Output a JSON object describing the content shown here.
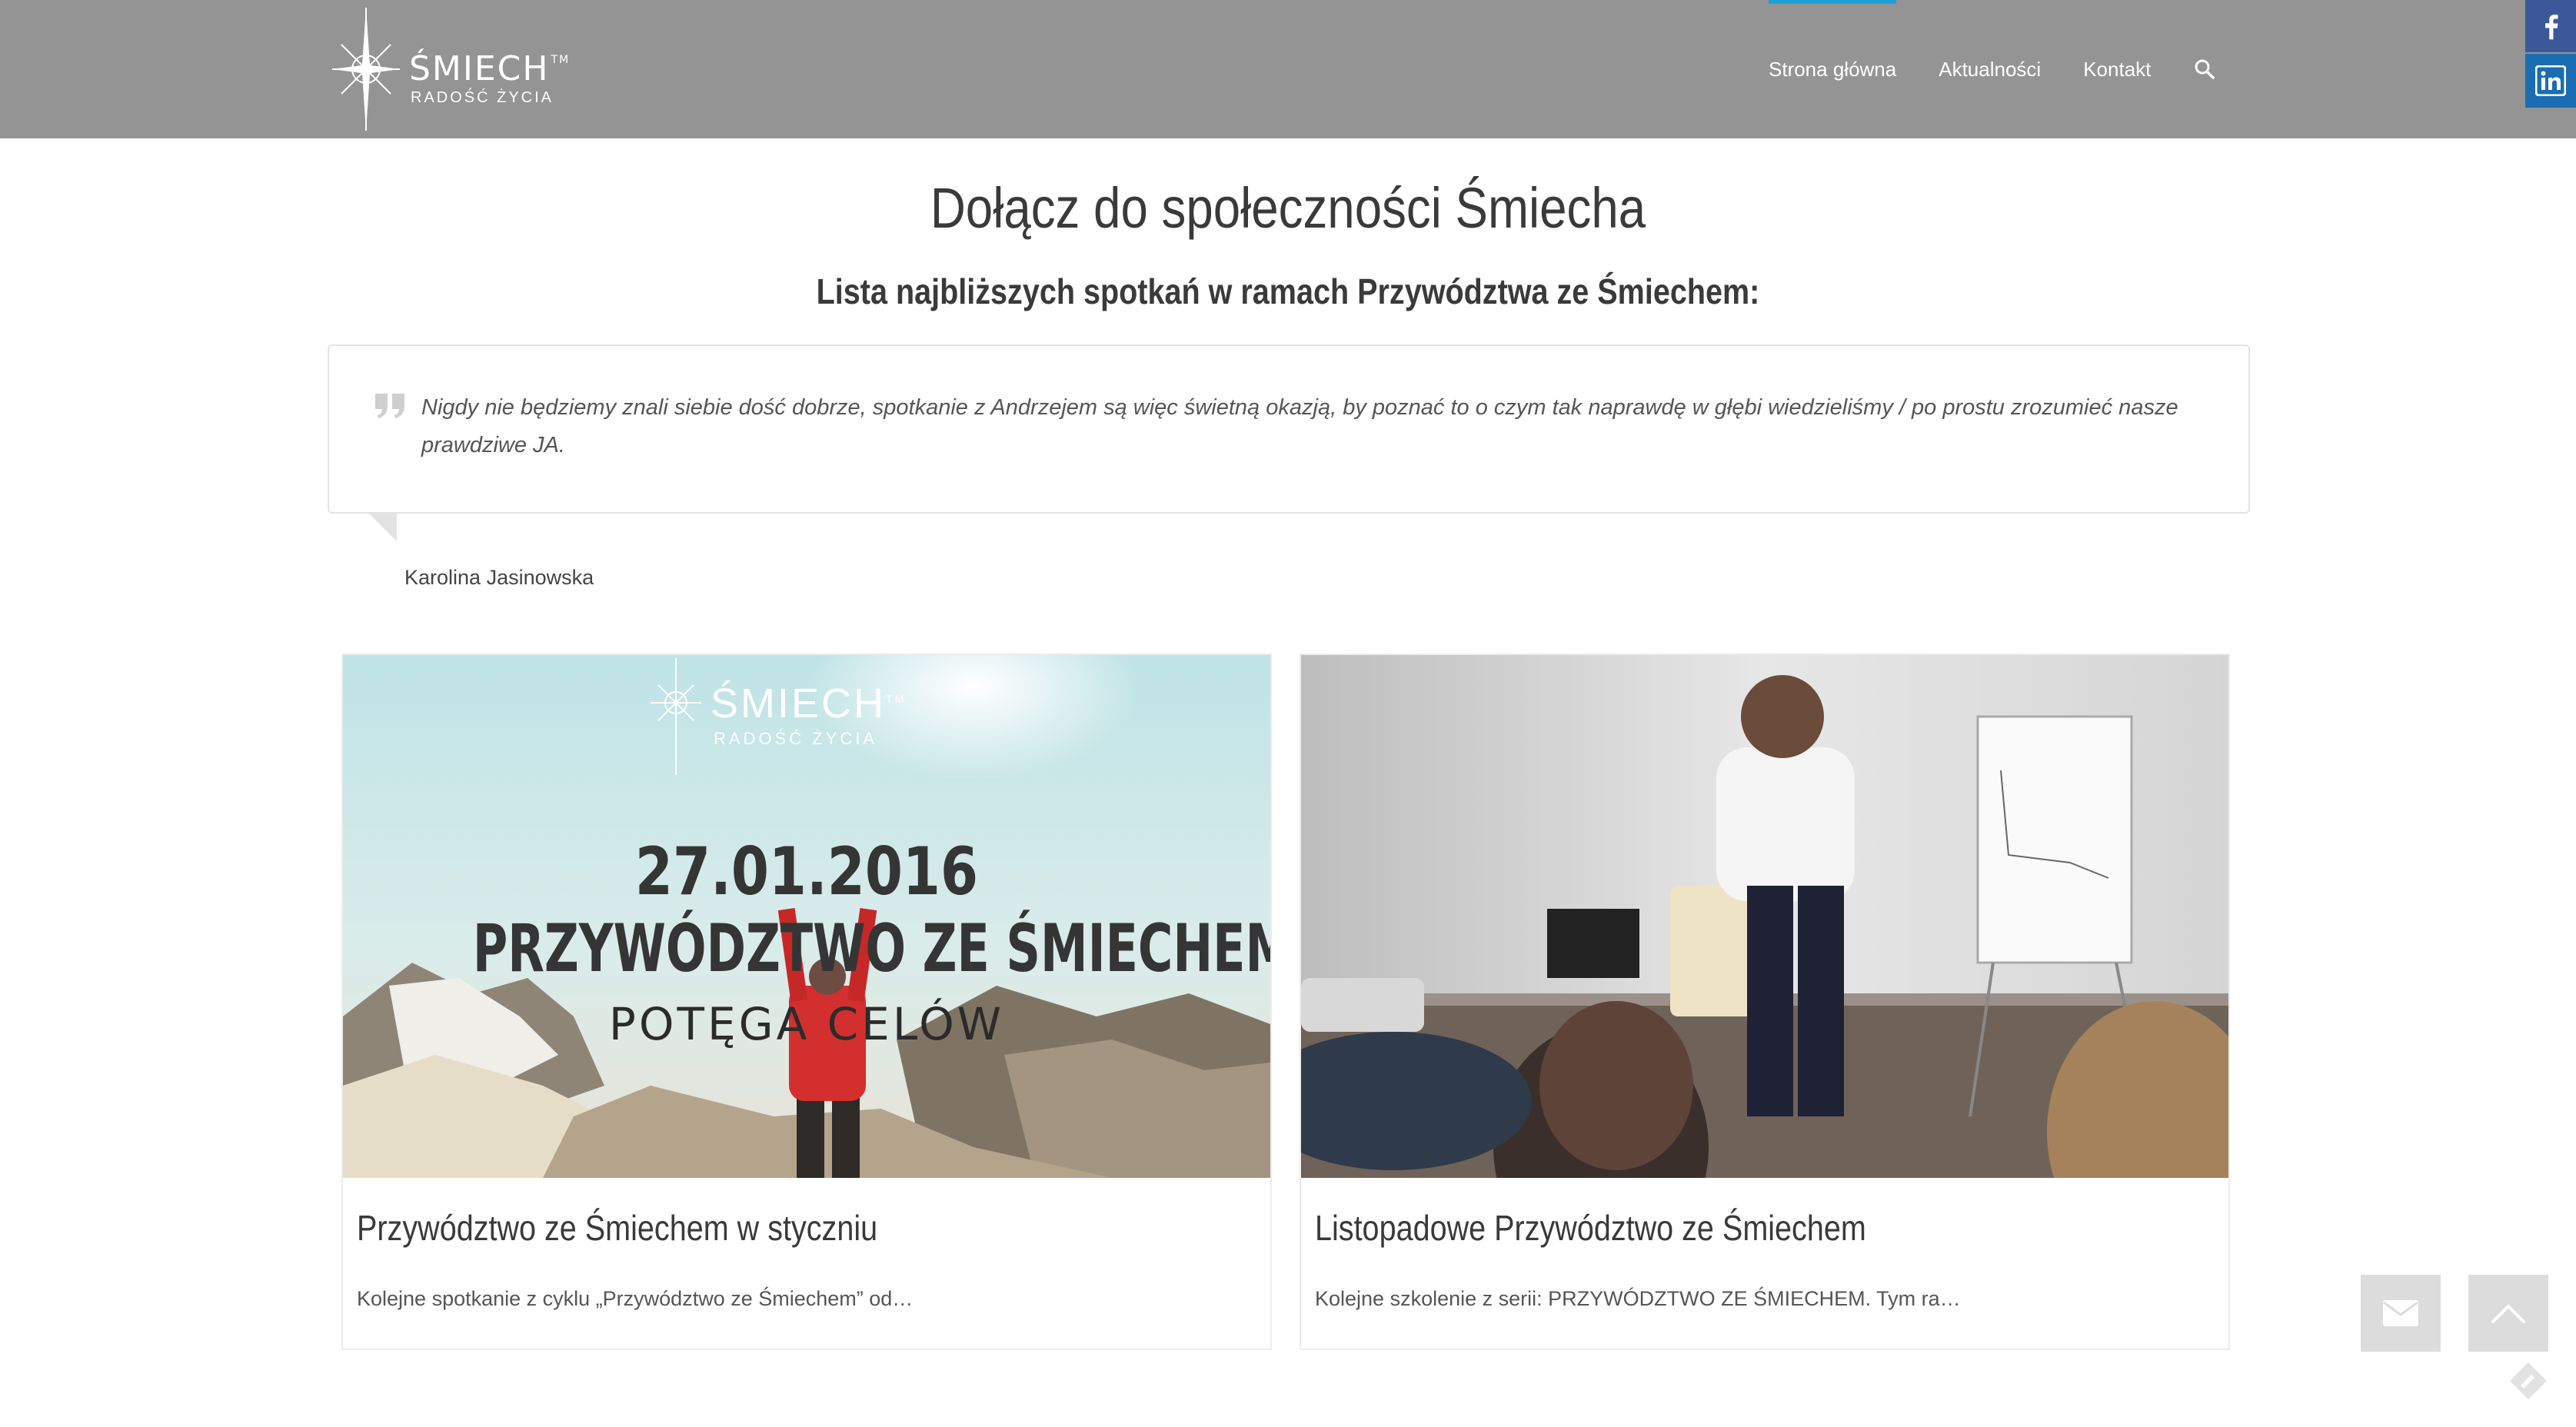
{
  "header": {
    "logo_name": "ŚMIECH",
    "logo_tm": "TM",
    "logo_sub": "RADOŚĆ ŻYCIA",
    "nav": [
      {
        "label": "Strona główna",
        "active": true
      },
      {
        "label": "Aktualności",
        "active": false
      },
      {
        "label": "Kontakt",
        "active": false
      }
    ],
    "social": [
      "facebook-icon",
      "linkedin-icon"
    ]
  },
  "main": {
    "title": "Dołącz do społeczności Śmiecha",
    "subtitle": "Lista najbliższych spotkań w ramach Przywództwa ze Śmiechem:",
    "quote": {
      "text": "Nigdy nie będziemy znali siebie dość dobrze, spotkanie z Andrzejem są więc świetną okazją, by poznać to o czym tak naprawdę w głębi wiedzieliśmy / po prostu zrozumieć nasze prawdziwe JA.",
      "author": "Karolina Jasinowska"
    },
    "cards": [
      {
        "title": "Przywództwo ze Śmiechem w styczniu",
        "excerpt": "Kolejne spotkanie z cyklu „Przywództwo ze Śmiechem” od…",
        "image": {
          "logo_name": "ŚMIECH",
          "logo_tm": "TM",
          "logo_sub": "RADOŚĆ ŻYCIA",
          "date": "27.01.2016",
          "headline": "PRZYWÓDZTWO ZE ŚMIECHEM",
          "tagline": "POTĘGA CELÓW"
        }
      },
      {
        "title": "Listopadowe Przywództwo ze Śmiechem",
        "excerpt": "Kolejne szkolenie z serii: PRZYWÓDZTWO ZE ŚMIECHEM. Tym ra…"
      }
    ]
  },
  "floating": {
    "mail_button": "envelope-icon",
    "top_button": "chevron-up-icon"
  },
  "colors": {
    "header_bg": "#949494",
    "accent": "#1e9ed8",
    "facebook": "#3b5998",
    "linkedin": "#1a6db3"
  }
}
